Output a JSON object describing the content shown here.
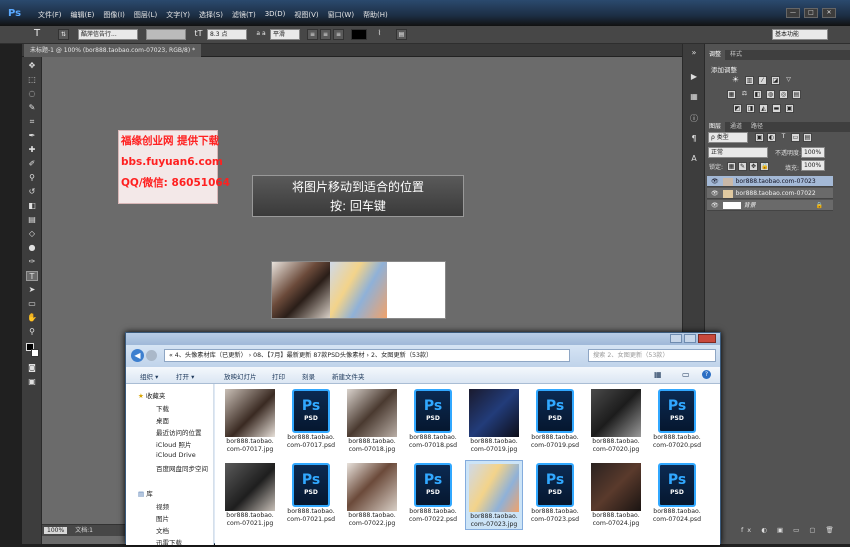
{
  "app": {
    "logo": "Ps",
    "menus": [
      "文件(F)",
      "编辑(E)",
      "图像(I)",
      "图层(L)",
      "文字(Y)",
      "选择(S)",
      "滤镜(T)",
      "3D(D)",
      "视图(V)",
      "窗口(W)",
      "帮助(H)"
    ],
    "window_controls": [
      "—",
      "□",
      "✕"
    ]
  },
  "options_bar": {
    "tool_glyph": "T",
    "font_family": "酷萍信告行...",
    "font_style": "",
    "font_size": "8.3 点",
    "aa_label": "a a",
    "aa_mode": "平滑",
    "workspace": "基本功能"
  },
  "document": {
    "tab_title": "未标题-1 @ 100% (bor888.taobao.com-07023, RGB/8) *",
    "zoom": "100%",
    "status_text": "文档:1"
  },
  "canvas": {
    "watermark_lines": [
      "福缘创业网 提供下载",
      "bbs.fuyuan6.com",
      "QQ/微信: 86051064"
    ],
    "hint_lines": [
      "将图片移动到适合的位置",
      "按: 回车键"
    ]
  },
  "panels": {
    "adjust_tabs": [
      "调整",
      "样式"
    ],
    "adjust_title": "添加调整",
    "layer_tabs": [
      "图层",
      "通道",
      "路径"
    ],
    "kind_label": "ρ 类型",
    "blend_mode": "正常",
    "opacity_label": "不透明度:",
    "opacity_value": "100%",
    "lock_label": "锁定:",
    "fill_label": "填充:",
    "fill_value": "100%",
    "layers": [
      {
        "name": "bor888.taobao.com-07023",
        "selected": true
      },
      {
        "name": "bor888.taobao.com-07022",
        "selected": false
      },
      {
        "name": "背景",
        "selected": false
      }
    ],
    "footer_icons": "fx ◐ ▣ ▭ ▢ 🗑"
  },
  "explorer": {
    "breadcrumb": "« 4、头像素材库（已更新） › 08、【7月】最新更新 87款PSD头像素材 › 2、女图更新（53款）",
    "search_placeholder": "搜索 2、女图更新（53款）",
    "toolbar": [
      "组织 ▾",
      "打开 ▾",
      "放映幻灯片",
      "打印",
      "刻录",
      "新建文件夹"
    ],
    "nav": [
      {
        "label": "收藏夹",
        "icon": "star-icon"
      },
      {
        "label": "下载",
        "icon": ""
      },
      {
        "label": "桌面",
        "icon": ""
      },
      {
        "label": "最近访问的位置",
        "icon": ""
      },
      {
        "label": "iCloud 照片",
        "icon": ""
      },
      {
        "label": "iCloud Drive",
        "icon": ""
      },
      {
        "label": "百度网盘同步空间",
        "icon": ""
      },
      {
        "label": "库",
        "icon": "library-icon"
      },
      {
        "label": "视频",
        "icon": ""
      },
      {
        "label": "图片",
        "icon": ""
      },
      {
        "label": "文档",
        "icon": ""
      },
      {
        "label": "迅雷下载",
        "icon": ""
      }
    ],
    "files": [
      {
        "name": "bor888.taobao.com-07017.jpg",
        "type": "jpg"
      },
      {
        "name": "bor888.taobao.com-07017.psd",
        "type": "psd"
      },
      {
        "name": "bor888.taobao.com-07018.jpg",
        "type": "jpg"
      },
      {
        "name": "bor888.taobao.com-07018.psd",
        "type": "psd"
      },
      {
        "name": "bor888.taobao.com-07019.jpg",
        "type": "jpg"
      },
      {
        "name": "bor888.taobao.com-07019.psd",
        "type": "psd"
      },
      {
        "name": "bor888.taobao.com-07020.jpg",
        "type": "jpg"
      },
      {
        "name": "bor888.taobao.com-07020.psd",
        "type": "psd"
      },
      {
        "name": "bor888.taobao.com-07021.jpg",
        "type": "jpg"
      },
      {
        "name": "bor888.taobao.com-07021.psd",
        "type": "psd"
      },
      {
        "name": "bor888.taobao.com-07022.jpg",
        "type": "jpg"
      },
      {
        "name": "bor888.taobao.com-07022.psd",
        "type": "psd"
      },
      {
        "name": "bor888.taobao.com-07023.jpg",
        "type": "jpg",
        "selected": true
      },
      {
        "name": "bor888.taobao.com-07023.psd",
        "type": "psd"
      },
      {
        "name": "bor888.taobao.com-07024.jpg",
        "type": "jpg"
      },
      {
        "name": "bor888.taobao.com-07024.psd",
        "type": "psd"
      }
    ],
    "ps_label": "Ps",
    "psd_label": "PSD"
  }
}
